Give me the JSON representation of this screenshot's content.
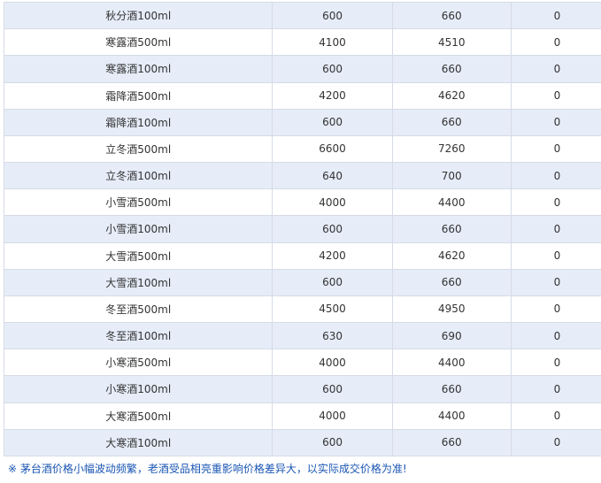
{
  "table": {
    "rows": [
      {
        "name": "秋分酒100ml",
        "price1": "600",
        "price2": "660",
        "change": "0"
      },
      {
        "name": "寒露酒500ml",
        "price1": "4100",
        "price2": "4510",
        "change": "0"
      },
      {
        "name": "寒露酒100ml",
        "price1": "600",
        "price2": "660",
        "change": "0"
      },
      {
        "name": "霜降酒500ml",
        "price1": "4200",
        "price2": "4620",
        "change": "0"
      },
      {
        "name": "霜降酒100ml",
        "price1": "600",
        "price2": "660",
        "change": "0"
      },
      {
        "name": "立冬酒500ml",
        "price1": "6600",
        "price2": "7260",
        "change": "0"
      },
      {
        "name": "立冬酒100ml",
        "price1": "640",
        "price2": "700",
        "change": "0"
      },
      {
        "name": "小雪酒500ml",
        "price1": "4000",
        "price2": "4400",
        "change": "0"
      },
      {
        "name": "小雪酒100ml",
        "price1": "600",
        "price2": "660",
        "change": "0"
      },
      {
        "name": "大雪酒500ml",
        "price1": "4200",
        "price2": "4620",
        "change": "0"
      },
      {
        "name": "大雪酒100ml",
        "price1": "600",
        "price2": "660",
        "change": "0"
      },
      {
        "name": "冬至酒500ml",
        "price1": "4500",
        "price2": "4950",
        "change": "0"
      },
      {
        "name": "冬至酒100ml",
        "price1": "630",
        "price2": "690",
        "change": "0"
      },
      {
        "name": "小寒酒500ml",
        "price1": "4000",
        "price2": "4400",
        "change": "0"
      },
      {
        "name": "小寒酒100ml",
        "price1": "600",
        "price2": "660",
        "change": "0"
      },
      {
        "name": "大寒酒500ml",
        "price1": "4000",
        "price2": "4400",
        "change": "0"
      },
      {
        "name": "大寒酒100ml",
        "price1": "600",
        "price2": "660",
        "change": "0"
      }
    ]
  },
  "footnote": "※ 茅台酒价格小幅波动频繁，老酒受品相亮重影响价格差异大，以实际成交价格为准!"
}
